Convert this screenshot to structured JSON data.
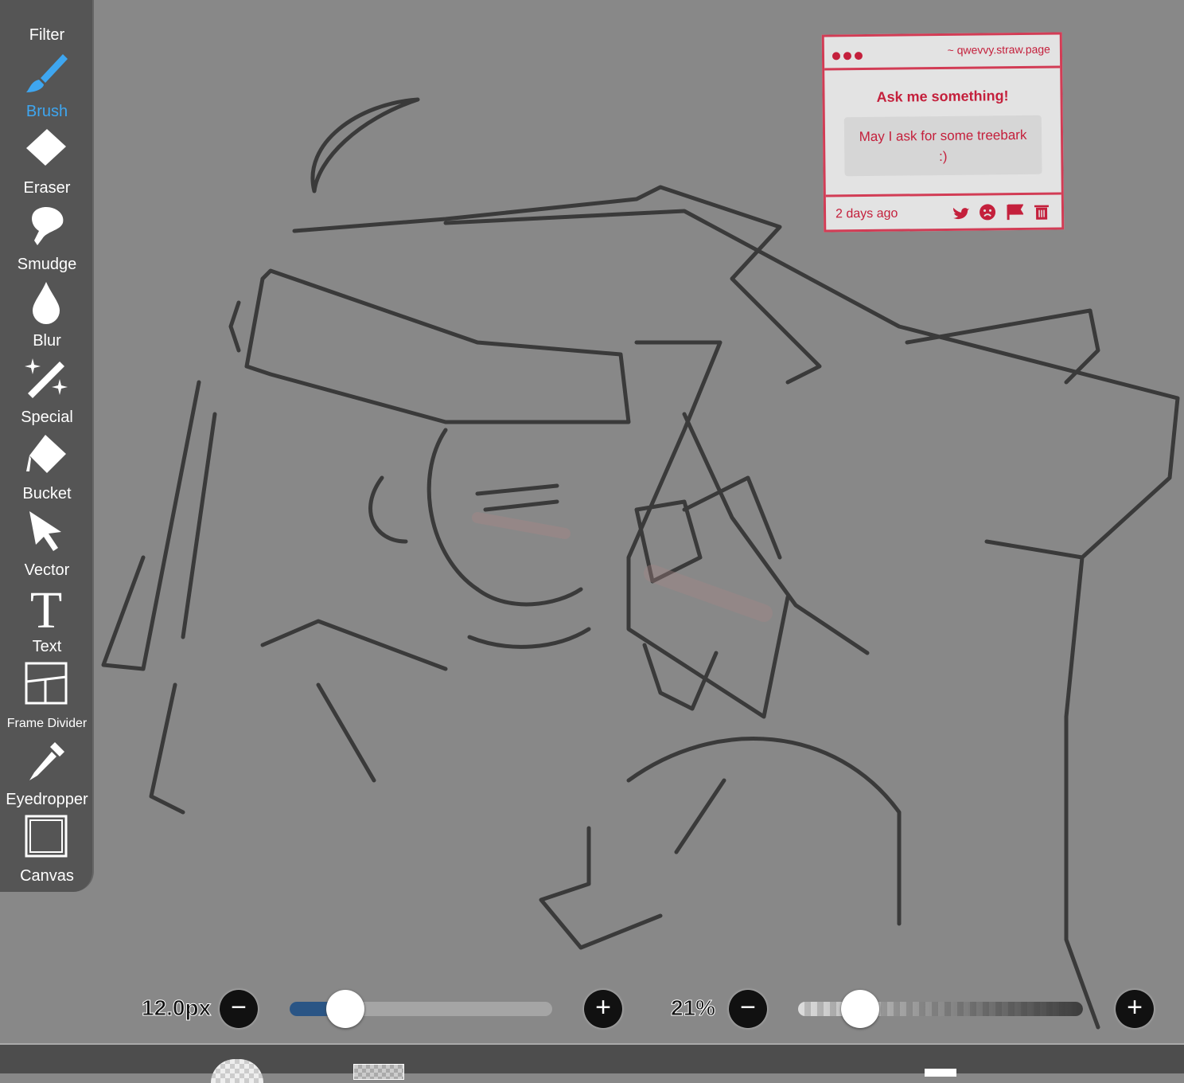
{
  "sidebar": {
    "tools": [
      {
        "label": "Filter",
        "icon": "filter-icon"
      },
      {
        "label": "Brush",
        "icon": "brush-icon",
        "active": true
      },
      {
        "label": "Eraser",
        "icon": "eraser-icon"
      },
      {
        "label": "Smudge",
        "icon": "smudge-icon"
      },
      {
        "label": "Blur",
        "icon": "blur-drop-icon"
      },
      {
        "label": "Special",
        "icon": "magic-wand-icon"
      },
      {
        "label": "Bucket",
        "icon": "bucket-icon"
      },
      {
        "label": "Vector",
        "icon": "cursor-arrow-icon"
      },
      {
        "label": "Text",
        "icon": "text-t-icon"
      },
      {
        "label": "Frame Divider",
        "icon": "frame-divider-icon"
      },
      {
        "label": "Eyedropper",
        "icon": "eyedropper-icon"
      },
      {
        "label": "Canvas",
        "icon": "canvas-icon"
      }
    ]
  },
  "card": {
    "url": "~ qwevvy.straw.page",
    "title": "Ask me something!",
    "question_line1": "May I ask for some treebark",
    "question_line2": ":)",
    "time": "2 days ago",
    "accent": "#c4203c"
  },
  "controls": {
    "brush_size": "12.0px",
    "brush_size_fraction": 0.2,
    "opacity": "21%",
    "opacity_fraction": 0.21,
    "minus": "−",
    "plus": "+",
    "slider_color": "#2a5585"
  }
}
